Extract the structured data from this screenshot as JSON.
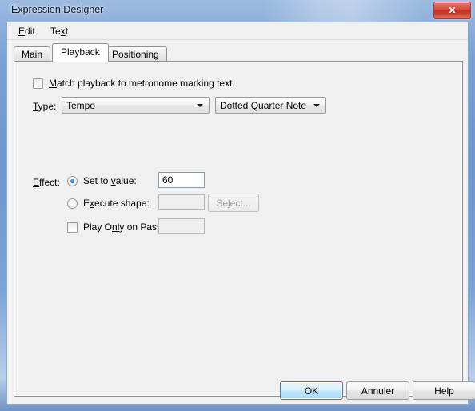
{
  "window": {
    "title": "Expression Designer",
    "close_label": "✕",
    "close_icon": "close-icon"
  },
  "menubar": {
    "items": [
      {
        "label": "Edit",
        "mnemonic_index": 0
      },
      {
        "label": "Text",
        "mnemonic_index": 2
      }
    ]
  },
  "tabs": [
    {
      "label": "Main",
      "selected": false
    },
    {
      "label": "Playback",
      "selected": true
    },
    {
      "label": "Positioning",
      "selected": false
    }
  ],
  "playback": {
    "match_checkbox": {
      "label_pre": "",
      "label_mnemonic": "M",
      "label_post": "atch playback to metronome marking text",
      "checked": false
    },
    "type_label_mnemonic": "T",
    "type_label_post": "ype:",
    "type_dropdown": {
      "value": "Tempo",
      "arrow_icon": "chevron-down-icon"
    },
    "note_dropdown": {
      "value": "Dotted Quarter Note",
      "arrow_icon": "chevron-down-icon"
    },
    "effect_label_mnemonic": "E",
    "effect_label_post": "ffect:",
    "set_to_value": {
      "label_pre": "Set to ",
      "label_mnemonic": "v",
      "label_post": "alue:",
      "selected": true,
      "field_value": "60"
    },
    "execute_shape": {
      "label_pre": "E",
      "label_mnemonic": "x",
      "label_post": "ecute shape:",
      "selected": false,
      "field_value": "",
      "select_button": {
        "label_pre": "Se",
        "label_mnemonic": "l",
        "label_post": "ect...",
        "disabled": true
      }
    },
    "play_only_on_pass": {
      "label_pre": "Play O",
      "label_mnemonic": "nl",
      "label_post": "y on Pass:",
      "checked": false,
      "field_value": ""
    }
  },
  "footer": {
    "ok_label": "OK",
    "cancel_label": "Annuler",
    "help_label": "Help"
  },
  "colors": {
    "frame_blue": "#6d97cf",
    "dialog_gray": "#f0f0f0",
    "accent_blue": "#3c7fb1",
    "close_red": "#bf3122"
  }
}
